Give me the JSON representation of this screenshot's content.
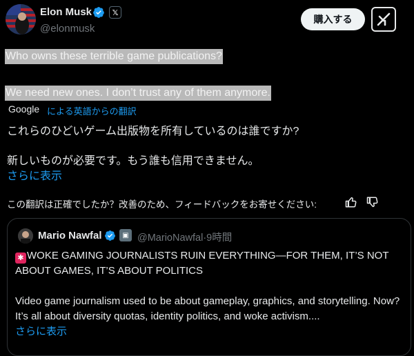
{
  "author": {
    "name": "Elon Musk",
    "handle": "@elonmusk"
  },
  "header": {
    "subscribe_label": "購入する"
  },
  "post": {
    "original_line1": "Who owns these terrible game publications?",
    "original_line2": "We need new ones. I don’t trust any of them anymore.",
    "translation_brand": "Google",
    "translation_note": "による英語からの翻訳",
    "translated_line1": "これらのひどいゲーム出版物を所有しているのは誰ですか?",
    "translated_line2": "新しいものが必要です。もう誰も信用できません。",
    "show_more": "さらに表示",
    "feedback_prompt": "この翻訳は正確でしたか？改善のため、フィードバックをお寄せください:"
  },
  "quote": {
    "name": "Mario Nawfal",
    "handle": "@MarioNawfal",
    "separator": "·",
    "time": "9時間",
    "headline": "WOKE GAMING JOURNALISTS RUIN EVERYTHING—FOR THEM, IT’S NOT ABOUT GAMES, IT’S ABOUT POLITICS",
    "body": "Video game journalism used to be about gameplay, graphics, and storytelling. Now? It’s all about diversity quotas, identity politics, and woke activism....",
    "show_more": "さらに表示"
  },
  "colors": {
    "accent": "#1d9bf0",
    "verified": "#1d9bf0",
    "highlight": "#b9b9b9",
    "background": "#000000"
  }
}
